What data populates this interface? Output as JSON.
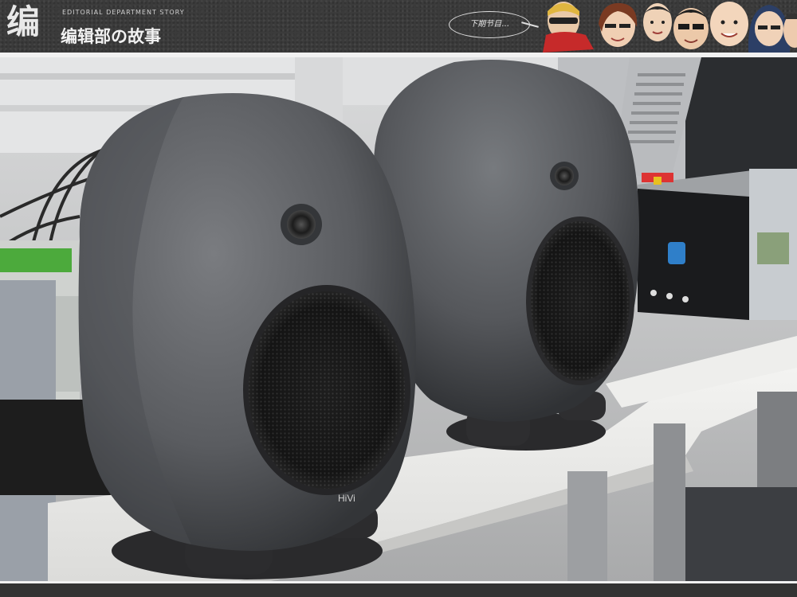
{
  "header": {
    "logo_mark": "编",
    "subtitle": "EDITORIAL DEPARTMENT STORY",
    "title": "编辑部の故事",
    "bubble_text": "下期节目..."
  },
  "photo": {
    "brand_label": "HiVi"
  },
  "colors": {
    "banner": "#3b3b3b",
    "speaker": "#5a5c60",
    "desk": "#eeeeec"
  }
}
